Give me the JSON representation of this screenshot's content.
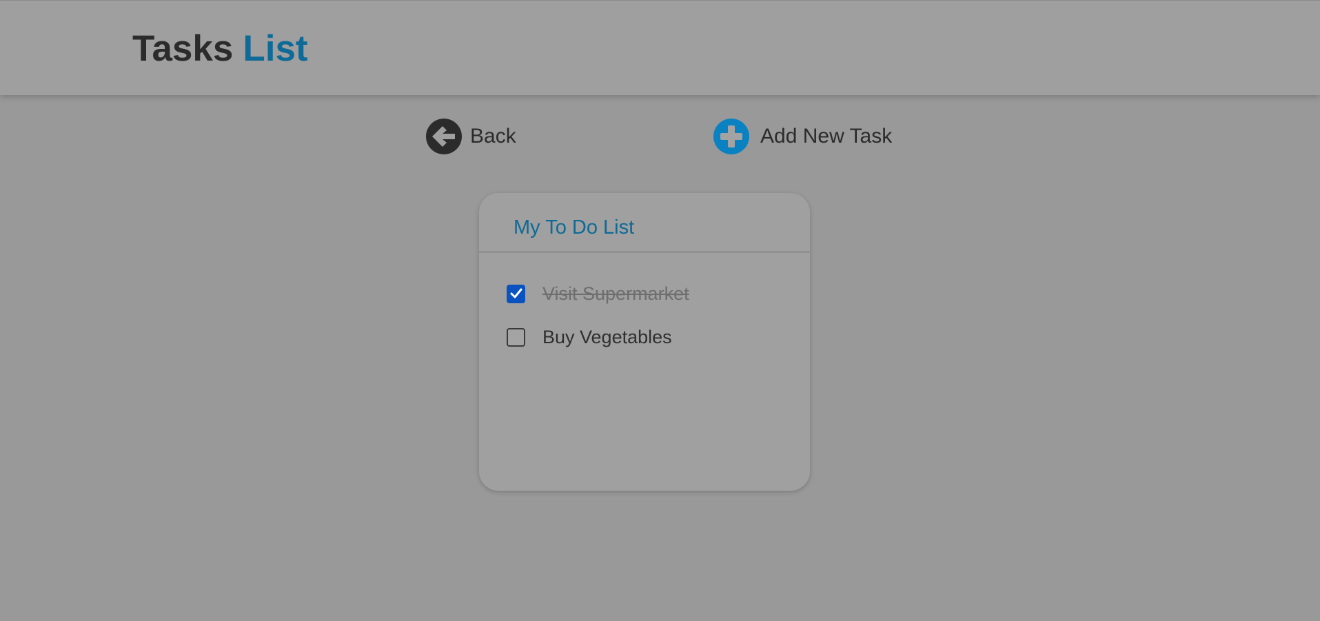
{
  "header": {
    "brand_word_1": "Tasks",
    "brand_word_2": "List"
  },
  "actions": {
    "back": {
      "label": "Back",
      "icon": "arrow-left-circle-icon"
    },
    "add": {
      "label": "Add New Task",
      "icon": "plus-circle-icon"
    }
  },
  "todo": {
    "title": "My To Do List",
    "tasks": [
      {
        "label": "Visit Supermarket",
        "done": true
      },
      {
        "label": "Buy Vegetables",
        "done": false
      }
    ]
  },
  "colors": {
    "page_background": "#999999",
    "brand_dark": "#2b2b2b",
    "brand_accent": "#0e6a97",
    "add_icon": "#0a82c1",
    "checkbox_checked": "#0a52c0"
  }
}
